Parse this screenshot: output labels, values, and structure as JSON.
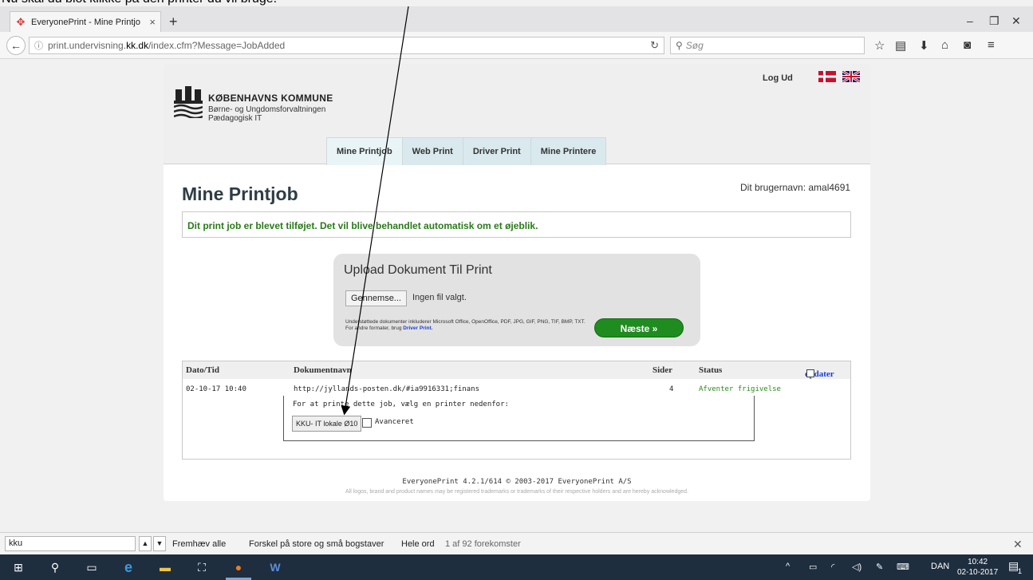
{
  "caption": "Nu skal du blot klikke på den printer du vil bruge.",
  "browser": {
    "tab_title": "EveryonePrint - Mine Printjo",
    "url_prefix": "print.undervisning.",
    "url_host": "kk.dk",
    "url_path": "/index.cfm?Message=JobAdded",
    "search_placeholder": "Søg"
  },
  "header": {
    "brand_name": "KØBENHAVNS KOMMUNE",
    "brand_sub1": "Børne- og Ungdomsforvaltningen",
    "brand_sub2": "Pædagogisk IT",
    "logout": "Log Ud",
    "tabs": [
      "Mine Printjob",
      "Web Print",
      "Driver Print",
      "Mine Printere"
    ]
  },
  "main": {
    "title": "Mine Printjob",
    "username": "Dit brugernavn: amal4691",
    "message": "Dit print job er blevet tilføjet. Det vil blive behandlet automatisk om et øjeblik."
  },
  "upload": {
    "title": "Upload Dokument Til Print",
    "browse_label": "Gennemse...",
    "no_file": "Ingen fil valgt.",
    "support_text": "Understøttede dokumenter inkluderer Microsoft Office, OpenOffice, PDF, JPG, GIF, PNG, TIF, BMP, TXT. For andre formater, brug",
    "support_link": "Driver Print.",
    "next_label": "Næste »"
  },
  "jobs": {
    "headers": {
      "date": "Dato/Tid",
      "doc": "Dokumentnavn",
      "pages": "Sider",
      "status": "Status",
      "refresh": "opdater"
    },
    "row": {
      "date": "02-10-17 10:40",
      "doc": "http://jyllands-posten.dk/#ia9916331;finans",
      "pages": "4",
      "status": "Afventer frigivelse"
    },
    "print_label": "For at printe dette job, vælg en printer nedenfor:",
    "printer": "KKU- IT lokale Ø10",
    "advanced": "Avanceret"
  },
  "footer": {
    "line1": "EveryonePrint 4.2.1/614 © 2003-2017 EveryonePrint A/S",
    "line2": "All logos, brand and product names may be registered trademarks or trademarks of their respective holders and are hereby acknowledged."
  },
  "findbar": {
    "query": "kku",
    "highlight_all": "Fremhæv alle",
    "match_case": "Forskel på store og små bogstaver",
    "whole_words": "Hele ord",
    "count": "1 af 92 forekomster"
  },
  "taskbar": {
    "lang": "DAN",
    "time": "10:42",
    "date": "02-10-2017",
    "notif_count": "1"
  },
  "colors": {
    "accent_green": "#1f8c1f",
    "message_green": "#2a7a1a",
    "link_blue": "#1a3fd6",
    "taskbar": "#1e2e3f"
  }
}
